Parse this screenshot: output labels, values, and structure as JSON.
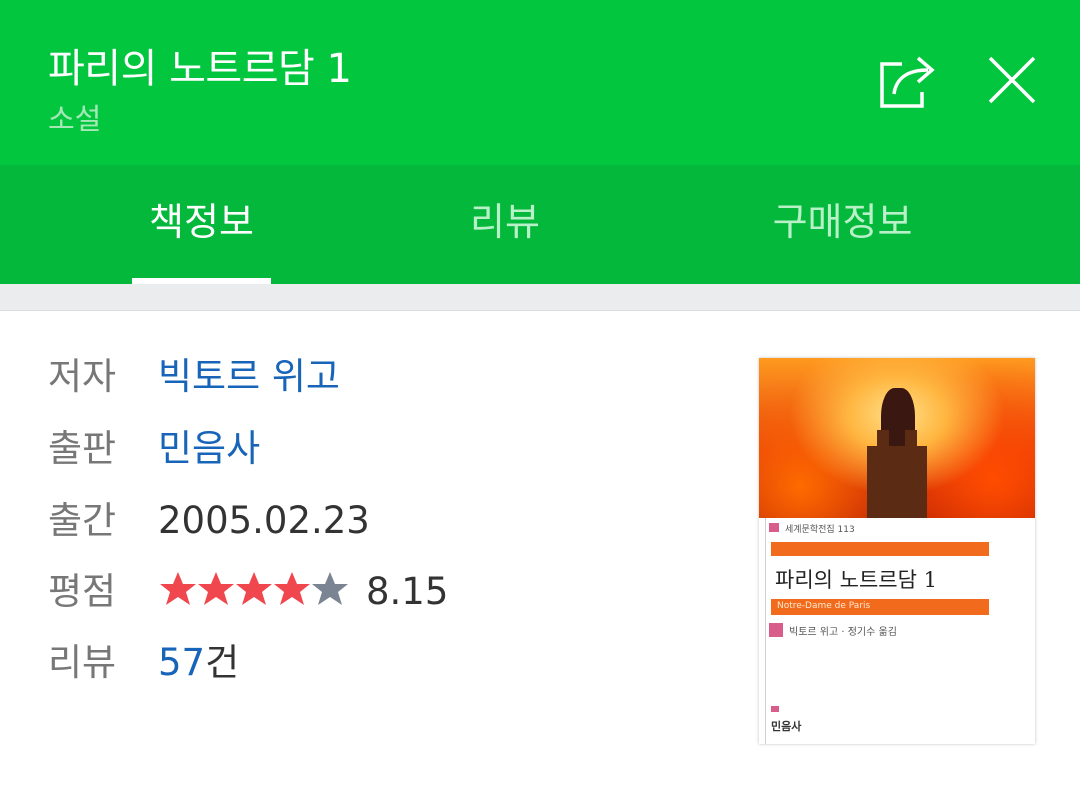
{
  "header": {
    "title": "파리의 노트르담 1",
    "subtitle": "소설",
    "share_icon": "share-icon",
    "close_icon": "close-icon"
  },
  "tabs": [
    {
      "label": "책정보",
      "active": true
    },
    {
      "label": "리뷰",
      "active": false
    },
    {
      "label": "구매정보",
      "active": false
    }
  ],
  "info": {
    "author_label": "저자",
    "author": "빅토르 위고",
    "publisher_label": "출판",
    "publisher": "민음사",
    "date_label": "출간",
    "date": "2005.02.23",
    "rating_label": "평점",
    "rating": "8.15",
    "stars_filled": 4,
    "stars_total": 5,
    "review_label": "리뷰",
    "review_count": "57",
    "review_unit": "건"
  },
  "cover": {
    "series": "세계문학전집 113",
    "title": "파리의 노트르담 1",
    "subtitle": "Notre-Dame de Paris",
    "author_line": "빅토르 위고 · 정기수 옮김",
    "publisher": "민음사"
  },
  "colors": {
    "header_bg": "#03c63f",
    "tabs_bg": "#03b83a",
    "link": "#1764b8",
    "star_filled": "#f0474f",
    "star_empty": "#7b8493"
  }
}
